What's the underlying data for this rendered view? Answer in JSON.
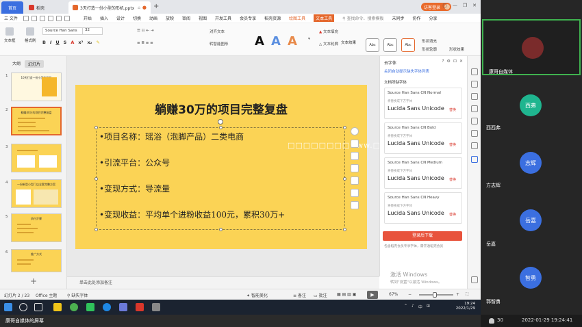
{
  "tabs": {
    "home": "首页",
    "wps": "稻壳",
    "doc": "3天打造一份小型的形机.pptx",
    "login": "访客登录"
  },
  "menu": {
    "file": "三 文件",
    "items": [
      "开始",
      "插入",
      "设计",
      "切换",
      "动画",
      "放映",
      "审阅",
      "视图",
      "开发工具",
      "会员专享",
      "稻壳资源",
      "绘图工具",
      "文本工具"
    ],
    "active_items": [
      "绘图工具",
      "文本工具"
    ],
    "search": "查找命令、搜索模板",
    "right_items": [
      "未同步",
      "协作",
      "分享"
    ]
  },
  "ribbon": {
    "textbox": "文本框",
    "paste_style": "格式刷",
    "font_name": "Source Han Sans",
    "font_size": "32",
    "align_text": "对齐文本",
    "convert_smartart": "转智能图形",
    "fill": "文本填充",
    "outline": "文本轮廓",
    "effect": "文本效果",
    "shape_fill": "形状填充",
    "shape_outline": "形状轮廓",
    "shape_effect": "形状效果",
    "style_labels": [
      "Abc",
      "Abc",
      "Abc"
    ]
  },
  "leftpane": {
    "tab_outline": "大纲",
    "tab_slides": "幻灯片",
    "thumbnails": [
      {
        "num": "1",
        "title": "10天打造一份小型的形机"
      },
      {
        "num": "2",
        "title": "躺赚30万的项目完整复盘"
      },
      {
        "num": "3",
        "title": ""
      },
      {
        "num": "4",
        "title": "一份新型小型门店全套完整方案"
      },
      {
        "num": "5",
        "title": "执行步骤"
      },
      {
        "num": "6",
        "title": "推广方式"
      }
    ]
  },
  "slide": {
    "title": "躺赚30万的项目完整复盘",
    "bullets": [
      "•项目名称：瑶浴（泡脚产品）二类电商",
      "•引流平台：公众号",
      "•变现方式：导流量",
      "•变现收益：平均单个进粉收益100元，累积30万+"
    ],
    "watermark": "□□□□□□□□www.□□"
  },
  "notes": "单击此处添加备注",
  "fontpanel": {
    "title": "云字体",
    "link": "关闭自动提示缺失字体列表",
    "section": "文档所缺字体",
    "hint": "将替换成下方字体",
    "replace": "替换",
    "cards": [
      {
        "src": "Source Han Sans CN Normal",
        "dst": "Lucida Sans Unicode"
      },
      {
        "src": "Source Han Sans CN Bold",
        "dst": "Lucida Sans Unicode"
      },
      {
        "src": "Source Han Sans CN Medium",
        "dst": "Lucida Sans Unicode"
      },
      {
        "src": "Source Han Sans CN Heavy",
        "dst": "Lucida Sans Unicode"
      }
    ],
    "download": "登录后下载",
    "note": "包含稻壳会员专享字体，需开通稻壳会员",
    "activate_title": "激活 Windows",
    "activate_sub": "转到\"设置\"以激活 Windows。"
  },
  "statusbar": {
    "slide_count": "幻灯片 2 / 23",
    "theme": "Office 主题",
    "missing_font": "缺失字体",
    "smart_beautify": "智能美化",
    "notes": "备注",
    "comments": "批注",
    "zoom": "67%"
  },
  "taskbar": {
    "time": "19:24",
    "date": "2022/1/29",
    "lang": "中"
  },
  "caption": "康哥自媒体的屏幕",
  "participants": {
    "list": [
      {
        "name": "康哥自媒体",
        "avatar": "",
        "color": "#7a2b2b"
      },
      {
        "name": "西西弗",
        "avatar": "西弗",
        "color": "#1fb58f"
      },
      {
        "name": "方志辉",
        "avatar": "志辉",
        "color": "#3b6fe0"
      },
      {
        "name": "岳嘉",
        "avatar": "岳嘉",
        "color": "#3b6fe0"
      },
      {
        "name": "郭智勇",
        "avatar": "智勇",
        "color": "#3b6fe0"
      }
    ],
    "count": "30",
    "datetime": "2022-01-29 19:24:41"
  }
}
